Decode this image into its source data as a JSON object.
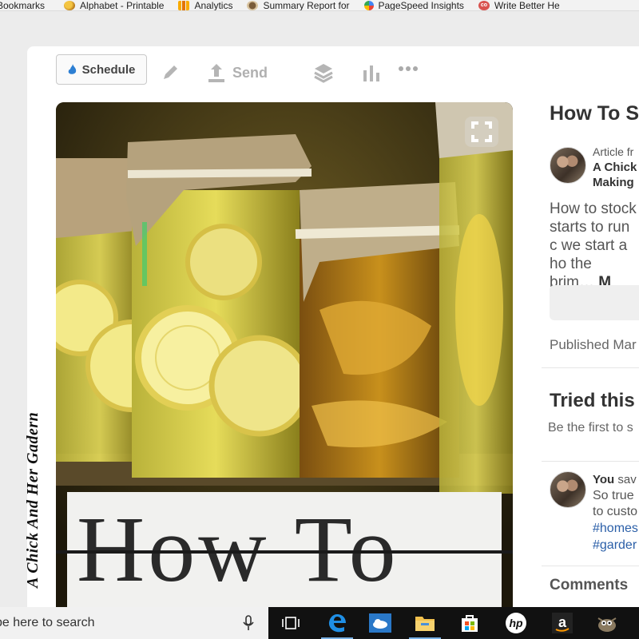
{
  "browser": {
    "bookmarks": [
      {
        "label": "Bookmarks",
        "icon": "folder-icon"
      },
      {
        "label": "Alphabet - Printable",
        "icon": "alphabet-favicon"
      },
      {
        "label": "Analytics",
        "icon": "analytics-favicon"
      },
      {
        "label": "Summary Report for",
        "icon": "summary-favicon"
      },
      {
        "label": "PageSpeed Insights",
        "icon": "pagespeed-favicon"
      },
      {
        "label": "Write Better He",
        "icon": "co-favicon"
      }
    ]
  },
  "toolbar": {
    "schedule_label": "Schedule",
    "send_label": "Send",
    "icons": [
      "pencil-icon",
      "upload-icon",
      "layers-icon",
      "bar-chart-icon",
      "more-icon"
    ]
  },
  "pin": {
    "watermark": "A Chick And Her Gadern",
    "overlay_title": "How To",
    "colors": {
      "panel_bg": "#f1f1ef",
      "title_text": "#2a2a2a"
    }
  },
  "details": {
    "title": "How To St",
    "article_from": "Article fr",
    "source_line1": "A Chick",
    "source_line2": "Making",
    "description": "How to stock starts to run c we start a ho the brim…",
    "more_label": "M",
    "published": "Published Mar",
    "tried_heading": "Tried this",
    "tried_sub": "Be the first to s",
    "comment_author": "You",
    "comment_verb": "sav",
    "comment_line1": "So true",
    "comment_line2": "to custo",
    "hashtag1": "#homes",
    "hashtag2": "#garder",
    "comments_heading": "Comments"
  },
  "taskbar": {
    "search_placeholder": "pe here to search",
    "apps": [
      "task-view-icon",
      "edge-icon",
      "weather-icon",
      "file-explorer-icon",
      "store-icon",
      "hp-icon",
      "amazon-icon",
      "gimp-icon"
    ]
  }
}
